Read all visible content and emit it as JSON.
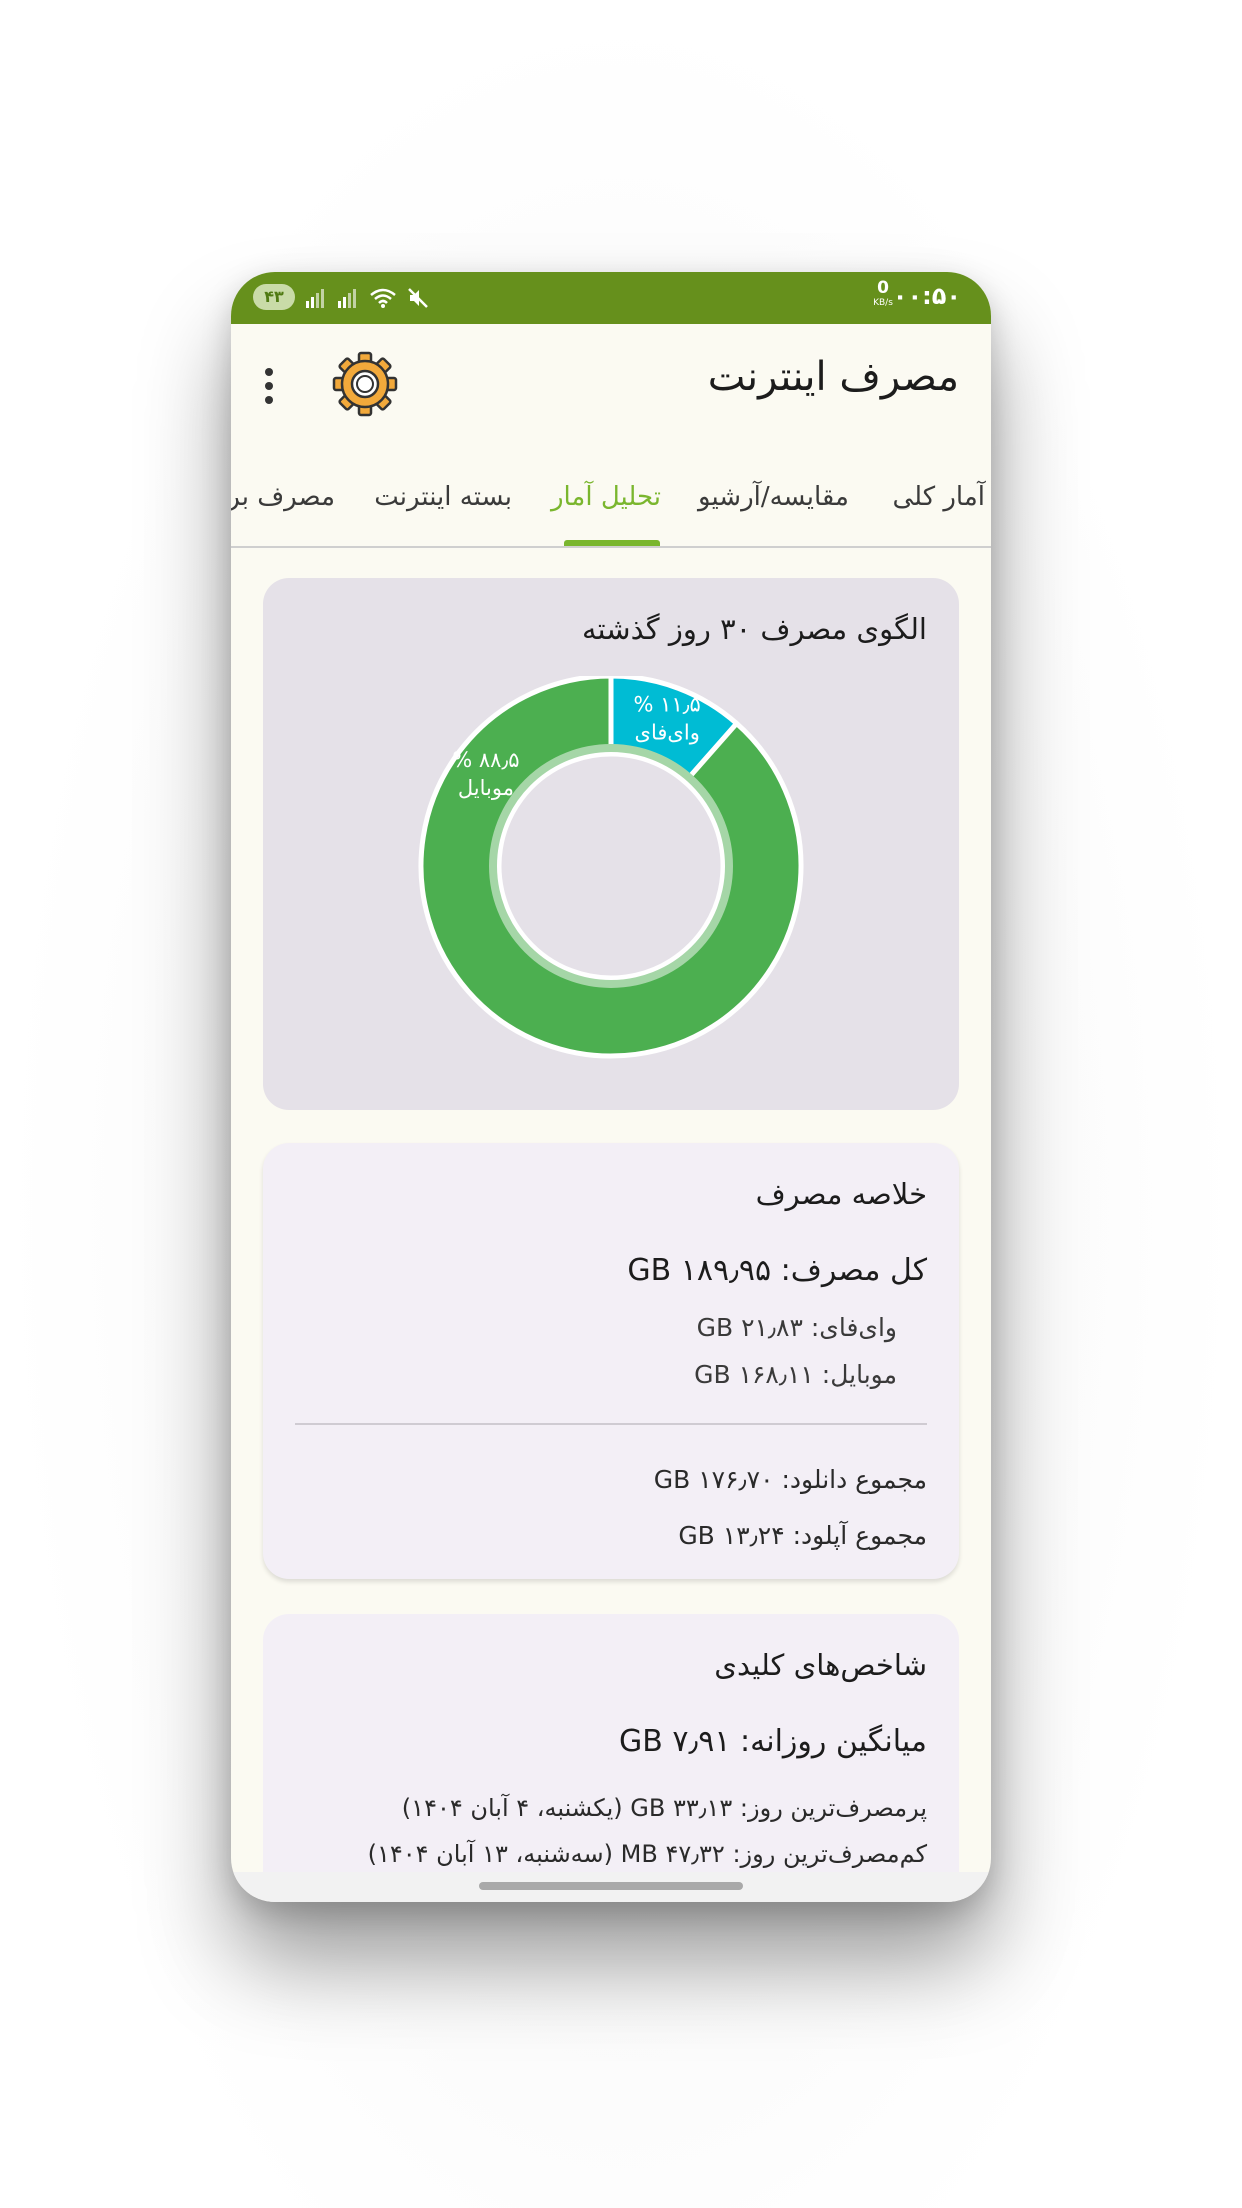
{
  "status_bar": {
    "battery": "۴۳",
    "time": "۰۰:۵۰",
    "net_speed_value": "0",
    "net_speed_unit": "KB/s",
    "icons": [
      "signal-icon",
      "signal-icon",
      "wifi-icon",
      "mute-icon"
    ]
  },
  "app_bar": {
    "title": "مصرف اینترنت",
    "settings_icon": "gear-icon",
    "menu_icon": "more-vert-icon"
  },
  "tabs": [
    {
      "label": "آمار کلی",
      "active": false
    },
    {
      "label": "مقایسه/آرشیو",
      "active": false
    },
    {
      "label": "تحلیل آمار",
      "active": true
    },
    {
      "label": "بسته اینترنت",
      "active": false
    },
    {
      "label": "مصرف برنا",
      "active": false
    }
  ],
  "pattern_card": {
    "title": "الگوی مصرف ۳۰ روز گذشته"
  },
  "chart_data": {
    "type": "pie",
    "title": "الگوی مصرف ۳۰ روز گذشته",
    "slices": [
      {
        "label": "وای‌فای",
        "value": 11.5,
        "display": "۱۱٫۵ %",
        "color": "#00bcd4"
      },
      {
        "label": "موبایل",
        "value": 88.5,
        "display": "۸۸٫۵ %",
        "color": "#4caf50"
      }
    ]
  },
  "summary_card": {
    "title": "خلاصه مصرف",
    "total": "کل مصرف: ۱۸۹٫۹۵ GB",
    "wifi": "وای‌فای: ۲۱٫۸۳ GB",
    "mobile": "موبایل: ۱۶۸٫۱۱ GB",
    "download": "مجموع دانلود: ۱۷۶٫۷۰ GB",
    "upload": "مجموع آپلود: ۱۳٫۲۴ GB"
  },
  "metrics_card": {
    "title": "شاخص‌های کلیدی",
    "daily_average": "میانگین روزانه: ۷٫۹۱ GB",
    "max_day": "پرمصرف‌ترین روز: ۳۳٫۱۳ GB (یکشنبه، ۴ آبان ۱۴۰۴)",
    "min_day": "کم‌مصرف‌ترین روز: ۴۷٫۳۲ MB (سه‌شنبه، ۱۳ آبان ۱۴۰۴)"
  },
  "colors": {
    "status_bar": "#66901c",
    "accent": "#7ab62e",
    "wifi": "#00bcd4",
    "mobile": "#4caf50"
  }
}
